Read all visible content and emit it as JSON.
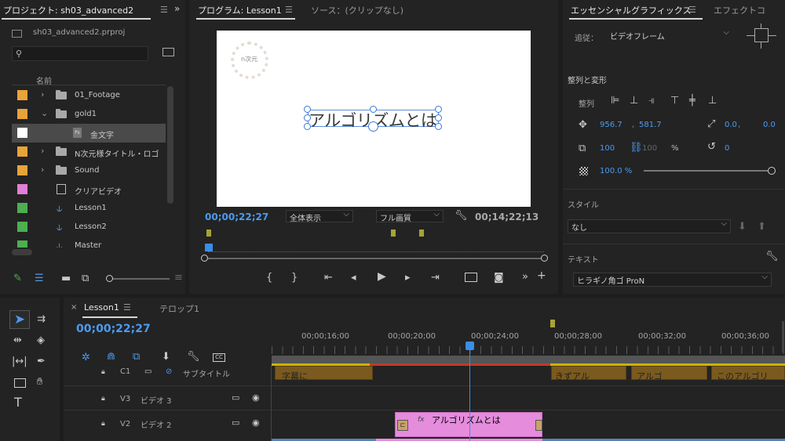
{
  "colors": {
    "accent": "#4c9bf0",
    "folder_orange": "#e8a33a",
    "green": "#4caf50",
    "pink": "#e07fd8",
    "clip_pink": "#e58cdd",
    "clip_brown": "#7a5a1e",
    "playhead": "#3a8ee6"
  },
  "project_panel": {
    "tab_label": "プロジェクト: sh03_advanced2",
    "menu_icon": "hamburger-icon",
    "file_name": "sh03_advanced2.prproj",
    "search_placeholder": "",
    "column_name": "名前",
    "items": [
      {
        "label": "01_Footage",
        "type": "folder",
        "color": "#e8a33a"
      },
      {
        "label": "gold1",
        "type": "folder",
        "color": "#e8a33a"
      },
      {
        "label": "金文字",
        "type": "graphic",
        "color": "#ffffff"
      },
      {
        "label": "N次元様タイトル・ロゴ",
        "type": "folder",
        "color": "#e8a33a"
      },
      {
        "label": "Sound",
        "type": "folder",
        "color": "#e8a33a"
      },
      {
        "label": "クリアビデオ",
        "type": "clip",
        "color": "#e07fd8"
      },
      {
        "label": "Lesson1",
        "type": "sequence",
        "color": "#4caf50"
      },
      {
        "label": "Lesson2",
        "type": "sequence",
        "color": "#4caf50"
      },
      {
        "label": "Master",
        "type": "sequence",
        "color": "#4caf50"
      }
    ]
  },
  "program_monitor": {
    "tab_label": "プログラム: Lesson1",
    "source_tab_label": "ソース：(クリップなし)",
    "title_text": "アルゴリズムとは",
    "logo_text": "n次元",
    "timecode_current": "00;00;22;27",
    "fit_label": "全体表示",
    "quality_label": "フル画質",
    "timecode_duration": "00;14;22;13"
  },
  "essential_graphics": {
    "tab_label": "エッセンシャルグラフィックス",
    "effects_tab_label": "エフェクトコ",
    "follow_label": "追従：",
    "follow_value": "ビデオフレーム",
    "align_section": "整列と変形",
    "align_label": "整列",
    "position_x": "956.7",
    "position_y": "581.7",
    "anchor_x": "0.0",
    "anchor_y": "0.0",
    "scale_w": "100",
    "scale_h": "100",
    "scale_unit": "%",
    "rotation": "0",
    "opacity": "100.0 %",
    "style_section": "スタイル",
    "style_value": "なし",
    "text_section": "テキスト",
    "font_value": "ヒラギノ角ゴ ProN"
  },
  "timeline": {
    "tab_label": "Lesson1",
    "second_tab_label": "テロップ1",
    "timecode": "00;00;22;27",
    "ruler_labels": [
      "00;00;16;00",
      "00;00;20;00",
      "00;00;24;00",
      "00;00;28;00",
      "00;00;32;00",
      "00;00;36;00"
    ],
    "tracks": [
      {
        "id": "C1",
        "name": "サブタイトル"
      },
      {
        "id": "V3",
        "name": "ビデオ 3"
      },
      {
        "id": "V2",
        "name": "ビデオ 2"
      }
    ],
    "caption_clips": [
      "字幕に",
      "きずアル",
      "アルゴ",
      "このアルゴリ"
    ],
    "graphic_clip_label": "アルゴリズムとは",
    "fx_badge": "fx"
  }
}
